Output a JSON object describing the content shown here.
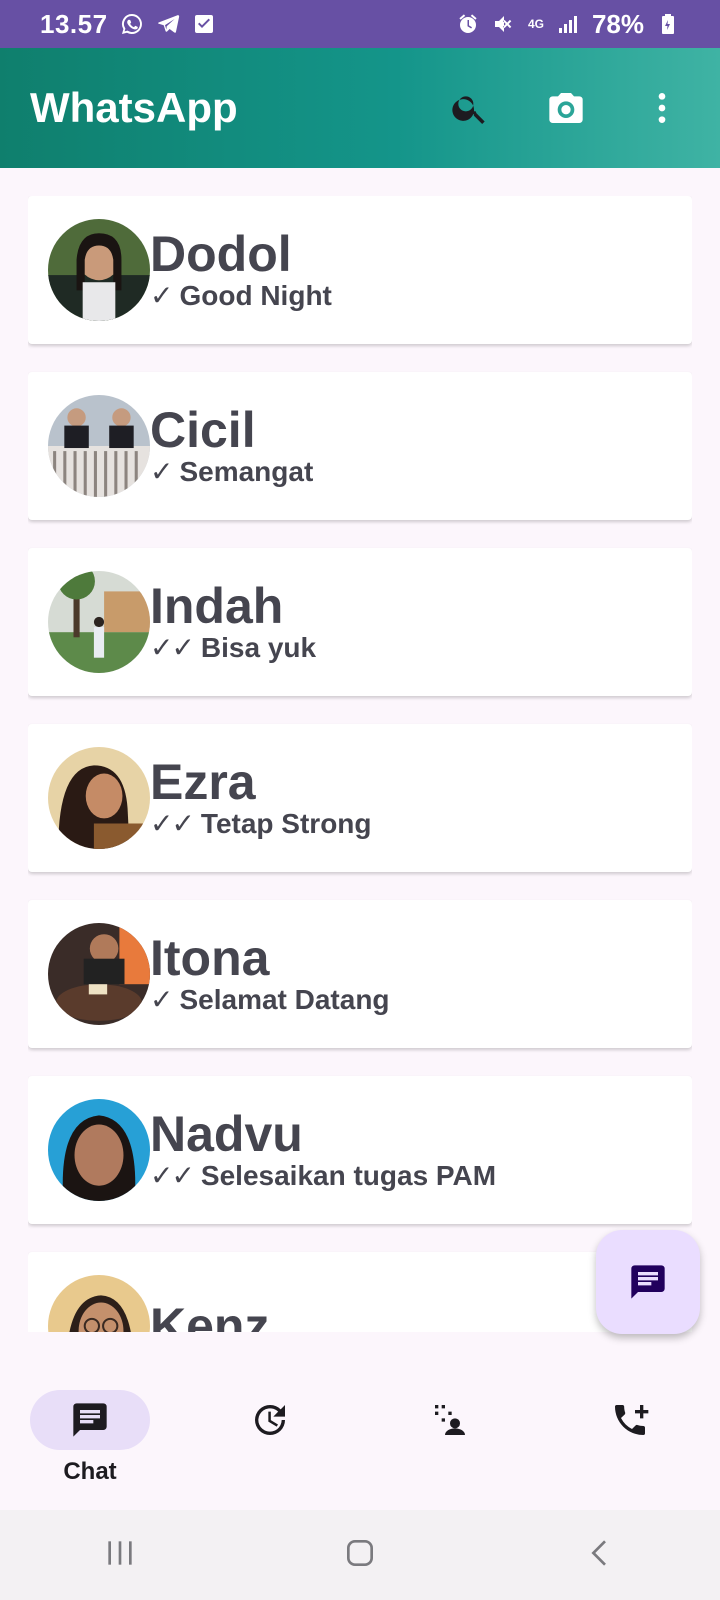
{
  "status_bar": {
    "time": "13.57",
    "network": "4G",
    "battery": "78%",
    "left_icons": [
      "whatsapp-icon",
      "telegram-icon",
      "checkbox-icon"
    ],
    "right_icons": [
      "alarm-icon",
      "mute-icon",
      "signal-icon",
      "battery-icon"
    ]
  },
  "app_bar": {
    "title": "WhatsApp",
    "actions": [
      "search-icon",
      "camera-icon",
      "more-vert-icon"
    ]
  },
  "chats": [
    {
      "name": "Dodol",
      "ticks": "✓",
      "message": "Good Night"
    },
    {
      "name": "Cicil",
      "ticks": "✓",
      "message": "Semangat"
    },
    {
      "name": "Indah",
      "ticks": "✓✓",
      "message": "Bisa yuk"
    },
    {
      "name": "Ezra",
      "ticks": "✓✓",
      "message": "Tetap Strong"
    },
    {
      "name": "Itona",
      "ticks": "✓",
      "message": "Selamat Datang"
    },
    {
      "name": "Nadvu",
      "ticks": "✓✓",
      "message": "Selesaikan tugas PAM"
    },
    {
      "name": "Kenz",
      "ticks": "",
      "message": ""
    }
  ],
  "fab": {
    "icon": "new-chat-icon"
  },
  "bottom_nav": {
    "items": [
      {
        "label": "Chat",
        "icon": "chat-icon",
        "active": true
      },
      {
        "label": "",
        "icon": "status-icon",
        "active": false
      },
      {
        "label": "",
        "icon": "communities-icon",
        "active": false
      },
      {
        "label": "",
        "icon": "add-call-icon",
        "active": false
      }
    ]
  },
  "colors": {
    "status_bar": "#6750a4",
    "app_bar_start": "#0f7f6d",
    "app_bar_end": "#3fb3a4",
    "fab": "#eaddff",
    "active_pill": "#e8def8",
    "name_text": "#45454f"
  }
}
